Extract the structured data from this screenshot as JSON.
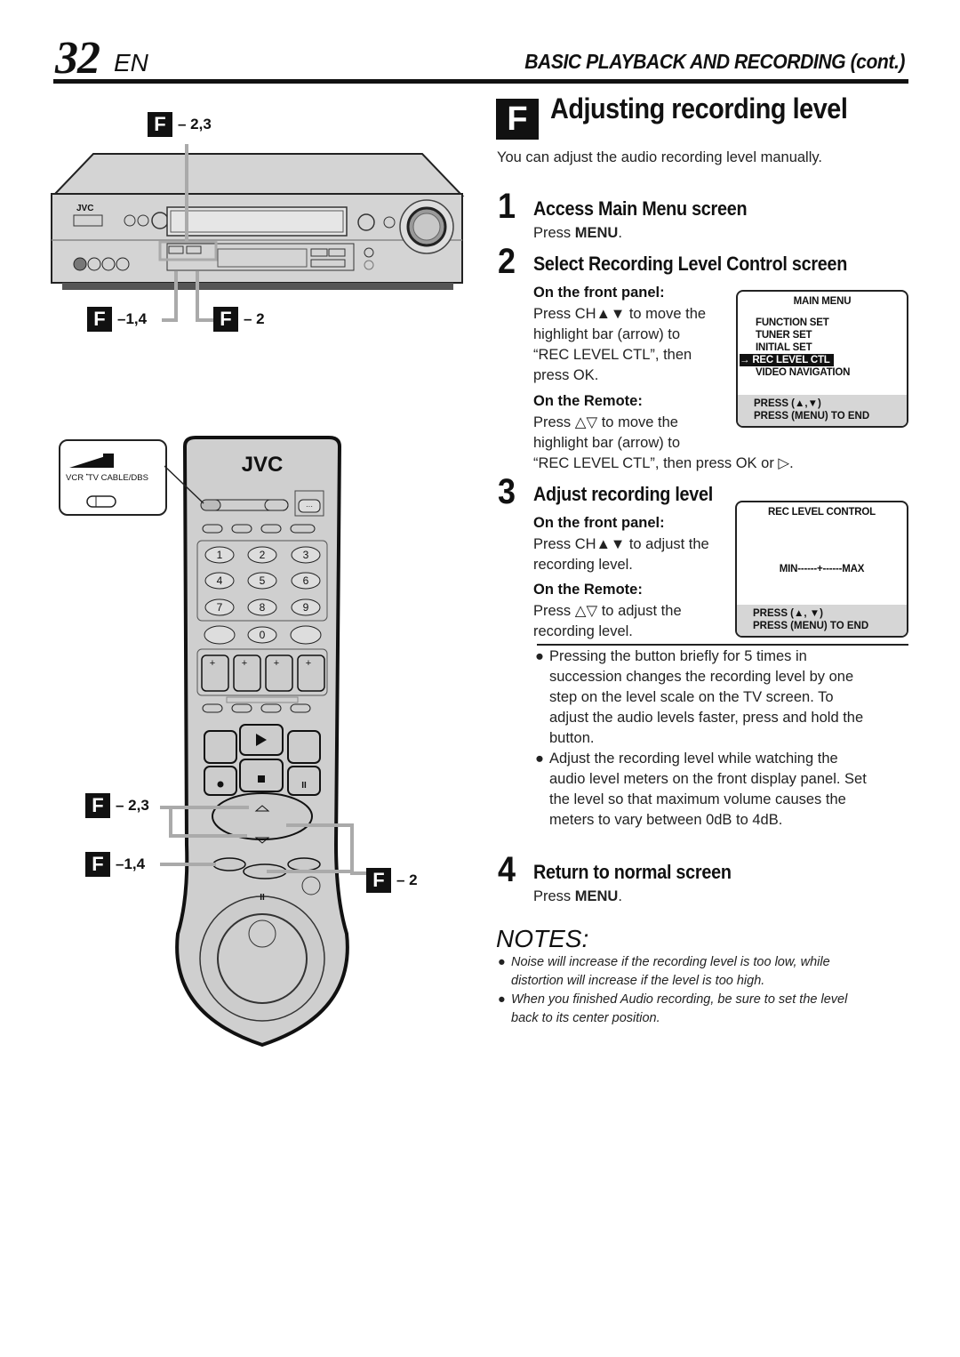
{
  "header": {
    "page_number": "32",
    "language": "EN",
    "section_title": "BASIC PLAYBACK AND RECORDING (cont.)"
  },
  "section": {
    "letter": "F",
    "title": "Adjusting recording level",
    "intro": "You can adjust the audio recording level manually."
  },
  "steps": [
    {
      "number": "1",
      "title": "Access Main Menu screen",
      "text_pre": "Press ",
      "text_bold": "MENU",
      "text_post": "."
    },
    {
      "number": "2",
      "title": "Select Recording Level Control screen",
      "front_panel_label": "On the front panel:",
      "front_panel_lines": [
        "Press CH▲▼ to move the",
        "highlight bar (arrow) to",
        "“REC LEVEL CTL”, then",
        "press OK."
      ],
      "remote_label": "On the Remote:",
      "remote_lines": [
        "Press △▽ to move the",
        "highlight bar (arrow) to",
        "“REC LEVEL CTL”, then press OK or ▷."
      ]
    },
    {
      "number": "3",
      "title": "Adjust recording level",
      "front_panel_label": "On the front panel:",
      "front_panel_lines": [
        "Press CH▲▼ to adjust the",
        "recording level."
      ],
      "remote_label": "On the Remote:",
      "remote_lines": [
        "Press △▽ to adjust the",
        "recording level."
      ]
    },
    {
      "number": "4",
      "title": "Return to normal screen",
      "text_pre": "Press ",
      "text_bold": "MENU",
      "text_post": "."
    }
  ],
  "osd_main_menu": {
    "title": "MAIN MENU",
    "items": [
      "FUNCTION SET",
      "TUNER SET",
      "INITIAL SET",
      "REC LEVEL CTL",
      "VIDEO NAVIGATION"
    ],
    "selected_index": 3,
    "arrow": "→",
    "footer": [
      "PRESS (▲,▼)",
      "PRESS (MENU) TO END"
    ]
  },
  "osd_rec_level": {
    "title": "REC LEVEL CONTROL",
    "scale": "MIN------+------MAX",
    "footer": [
      "PRESS (▲, ▼)",
      "PRESS (MENU) TO END"
    ]
  },
  "bullets": [
    [
      "Pressing the button briefly for 5 times in",
      "succession changes the recording level by one",
      "step on the level scale on the TV screen. To",
      "adjust the audio levels faster, press and hold the",
      "button."
    ],
    [
      "Adjust the recording level while watching the",
      "audio level meters on the front display panel. Set",
      "the level so that maximum volume causes the",
      "meters to vary between 0dB to 4dB."
    ]
  ],
  "notes": {
    "title": "NOTES:",
    "items": [
      [
        "Noise will increase if the recording level is too low, while",
        "distortion will increase if the level is too high."
      ],
      [
        "When you finished Audio recording, be sure to set the level",
        "back to its center position."
      ]
    ]
  },
  "vcr_callouts": {
    "top": "– 2,3",
    "bottom_left": "–1,4",
    "bottom_right": "– 2"
  },
  "remote_callouts": {
    "upper_left": "– 2,3",
    "lower_left": "–1,4",
    "right": "– 2"
  },
  "vcr": {
    "brand": "JVC"
  },
  "remote": {
    "brand": "JVC",
    "switch_labels": [
      "VCR",
      "TV",
      "CABLE/DBS"
    ],
    "keypad": [
      "1",
      "2",
      "3",
      "4",
      "5",
      "6",
      "7",
      "8",
      "9",
      "0"
    ],
    "menu_key": "···"
  }
}
